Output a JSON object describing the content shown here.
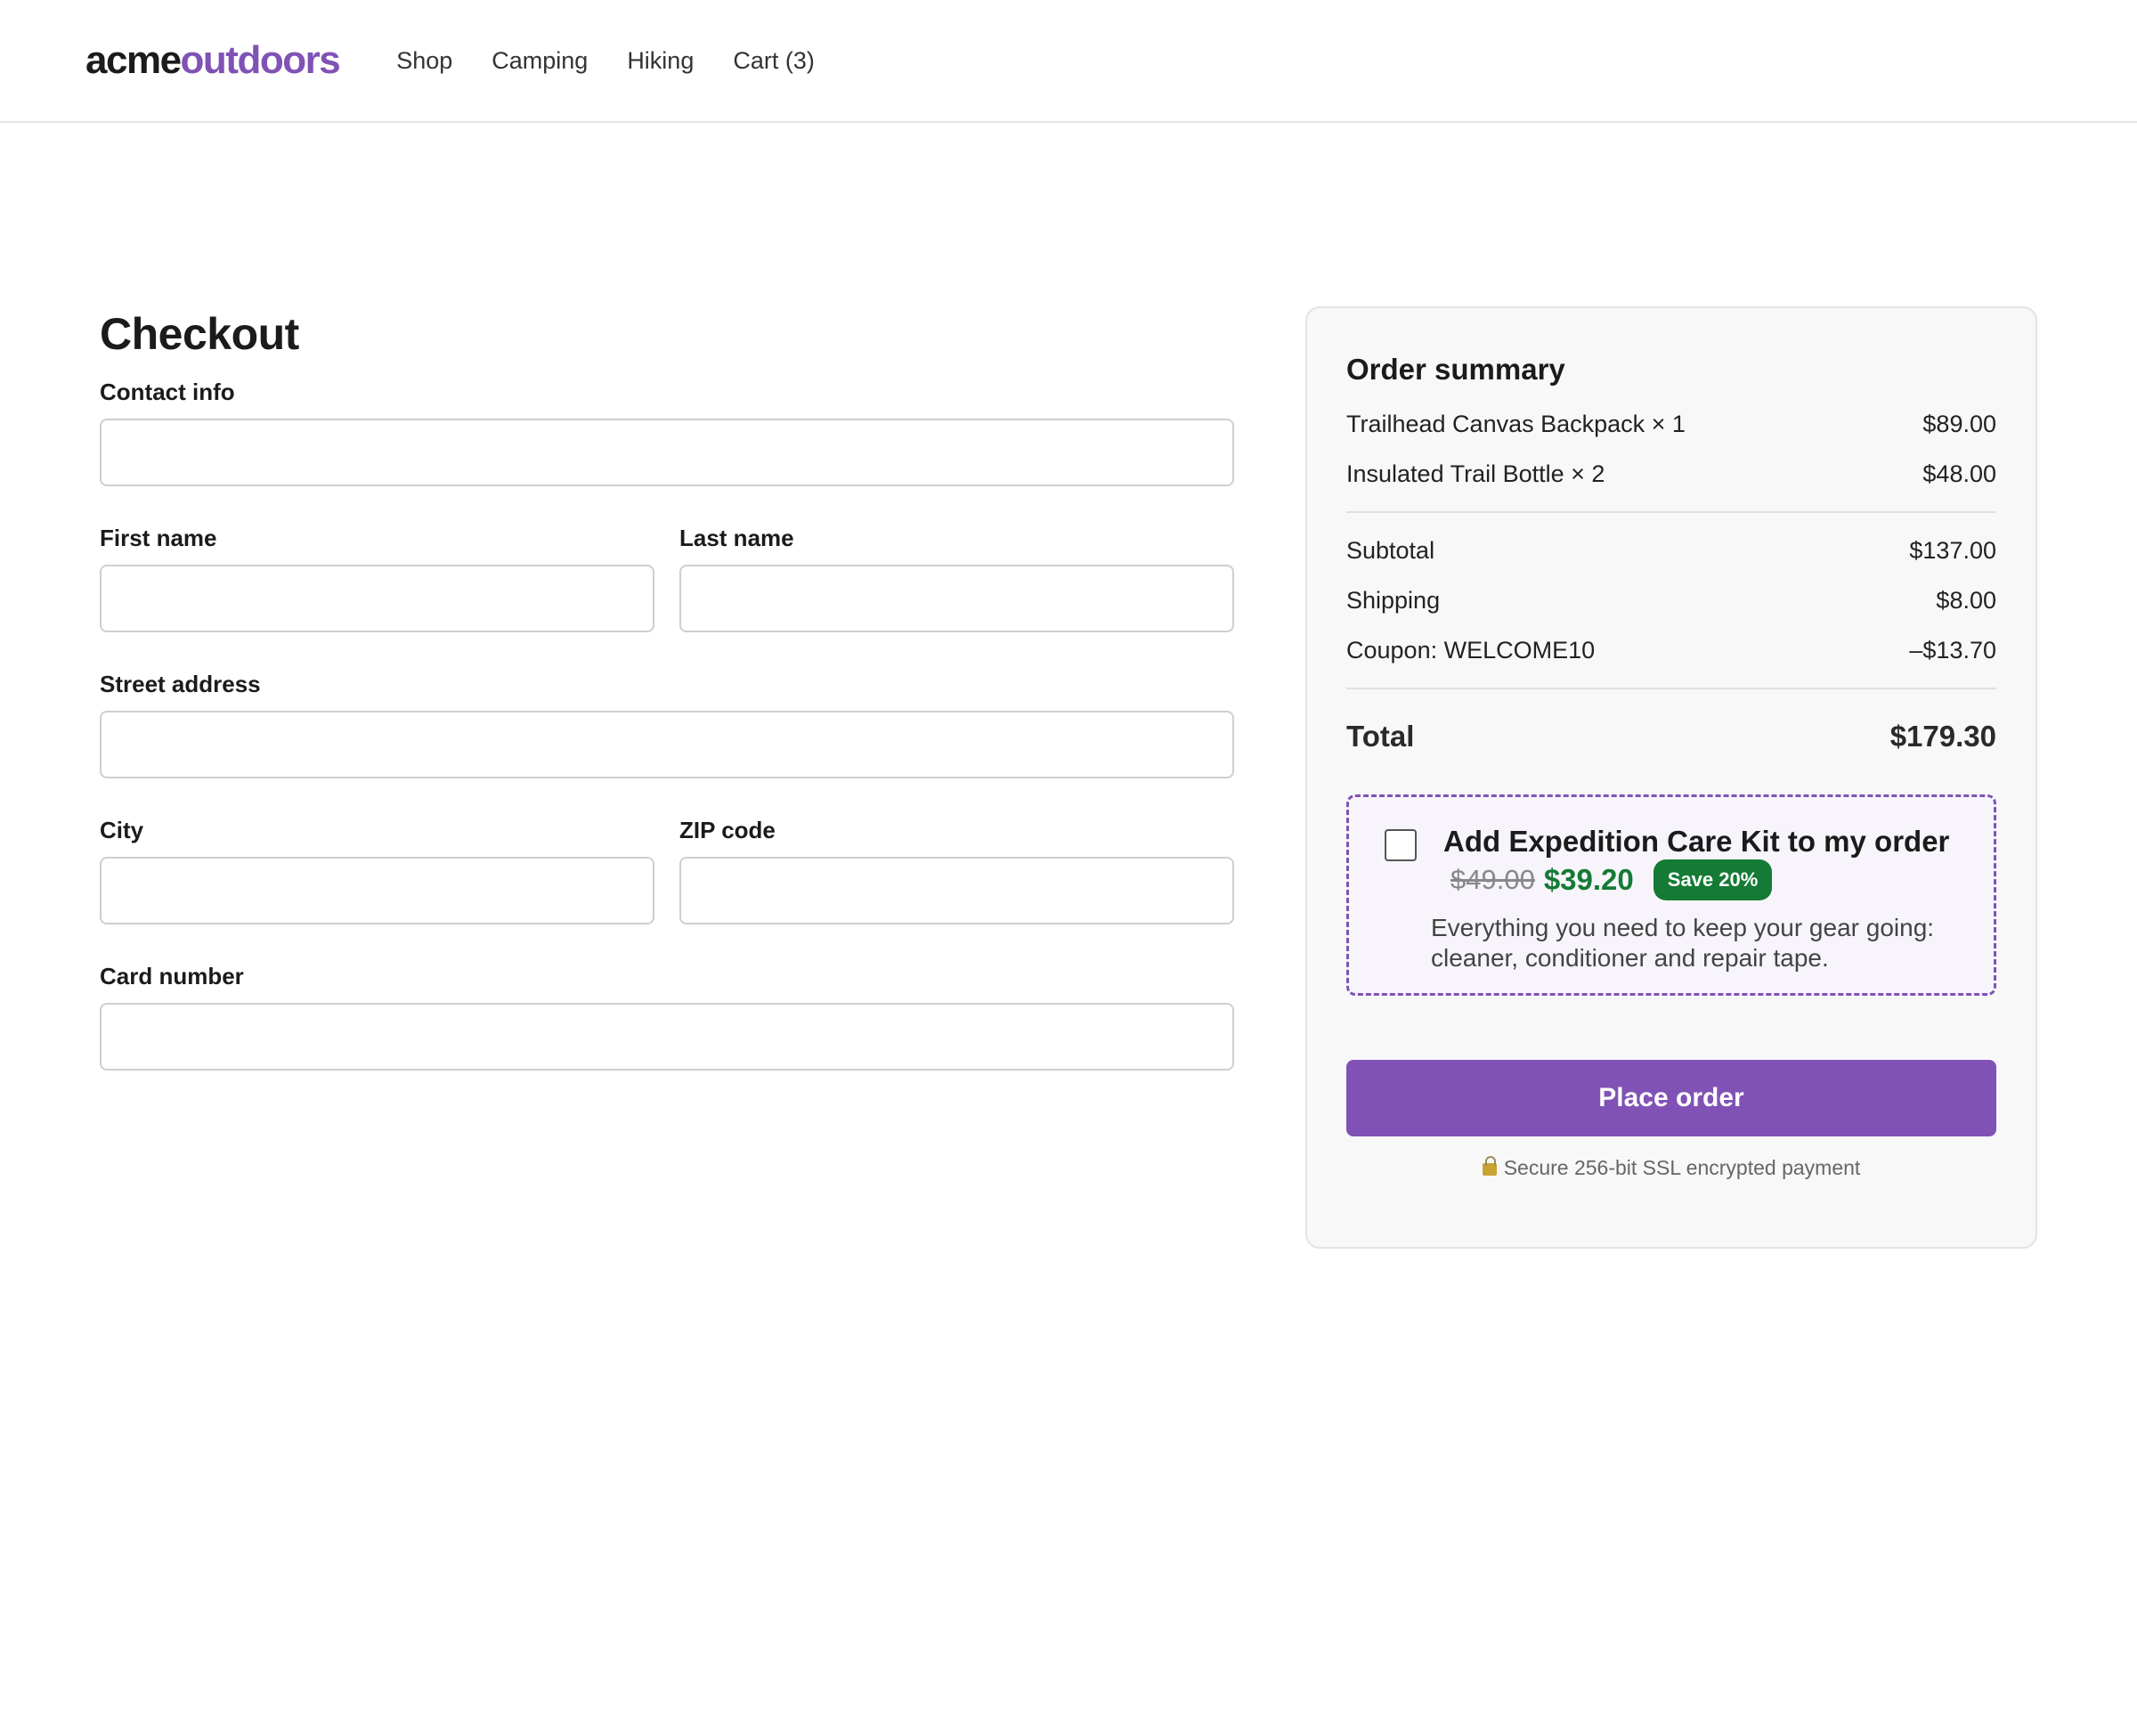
{
  "brand": {
    "part1": "acme",
    "part2": "outdoors"
  },
  "nav": [
    "Shop",
    "Camping",
    "Hiking",
    "Cart (3)"
  ],
  "checkout": {
    "title": "Checkout",
    "fields": {
      "contact": "Contact info",
      "first_name": "First name",
      "last_name": "Last name",
      "street": "Street address",
      "city": "City",
      "zip": "ZIP code",
      "card": "Card number"
    }
  },
  "summary": {
    "title": "Order summary",
    "items": [
      {
        "name": "Trailhead Canvas Backpack × 1",
        "price": "$89.00"
      },
      {
        "name": "Insulated Trail Bottle × 2",
        "price": "$48.00"
      }
    ],
    "subtotal": {
      "label": "Subtotal",
      "value": "$137.00"
    },
    "shipping": {
      "label": "Shipping",
      "value": "$8.00"
    },
    "coupon": {
      "label": "Coupon: WELCOME10",
      "value": "–$13.70"
    },
    "total": {
      "label": "Total",
      "value": "$179.30"
    }
  },
  "upsell": {
    "checked": false,
    "title": "Add Expedition Care Kit to my order",
    "old_price": "$49.00",
    "new_price": "$39.20",
    "badge": "Save 20%",
    "description": "Everything you need to keep your gear going: cleaner, conditioner and repair tape."
  },
  "place_order": "Place order",
  "secure_note": "Secure 256-bit SSL encrypted payment",
  "colors": {
    "accent": "#8052b5",
    "success": "#147a35"
  },
  "icons": {
    "lock": "lock-icon"
  }
}
